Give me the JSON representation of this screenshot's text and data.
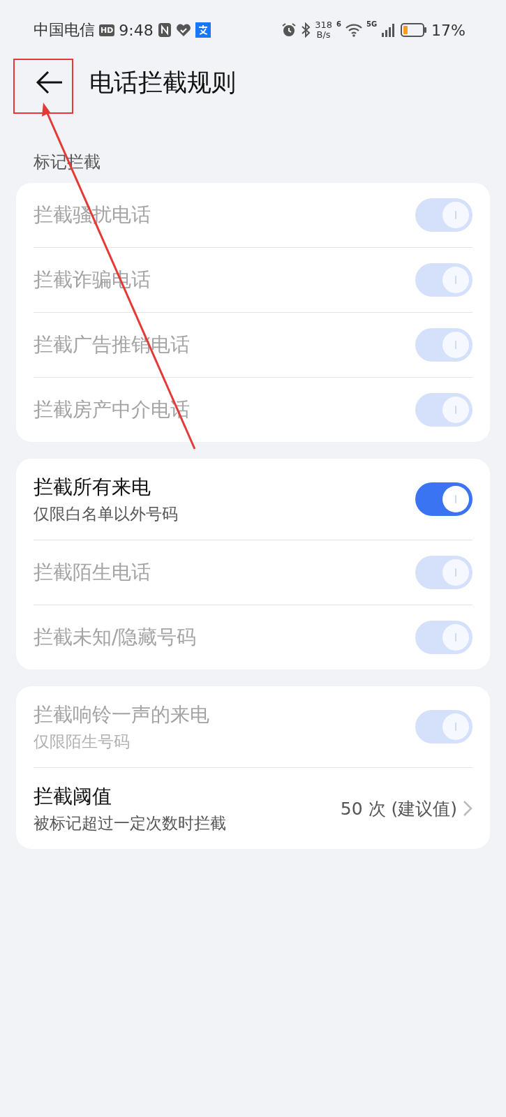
{
  "status_bar": {
    "carrier": "中国电信",
    "hd": "HD",
    "time": "9:48",
    "speed_value": "318",
    "speed_unit": "B/s",
    "wifi_label": "6",
    "network": "5G",
    "battery": "17%"
  },
  "header": {
    "title": "电话拦截规则"
  },
  "sections": [
    {
      "label": "标记拦截",
      "rows": [
        {
          "kind": "toggle",
          "title": "拦截骚扰电话",
          "on": true,
          "disabled": true
        },
        {
          "kind": "toggle",
          "title": "拦截诈骗电话",
          "on": true,
          "disabled": true
        },
        {
          "kind": "toggle",
          "title": "拦截广告推销电话",
          "on": true,
          "disabled": true
        },
        {
          "kind": "toggle",
          "title": "拦截房产中介电话",
          "on": true,
          "disabled": true
        }
      ]
    },
    {
      "rows": [
        {
          "kind": "toggle",
          "title": "拦截所有来电",
          "subtitle": "仅限白名单以外号码",
          "on": true,
          "disabled": false
        },
        {
          "kind": "toggle",
          "title": "拦截陌生电话",
          "on": true,
          "disabled": true
        },
        {
          "kind": "toggle",
          "title": "拦截未知/隐藏号码",
          "on": true,
          "disabled": true
        }
      ]
    },
    {
      "rows": [
        {
          "kind": "toggle",
          "title": "拦截响铃一声的来电",
          "subtitle": "仅限陌生号码",
          "on": true,
          "disabled": true
        },
        {
          "kind": "link",
          "title": "拦截阈值",
          "subtitle": "被标记超过一定次数时拦截",
          "value": "50 次 (建议值)"
        }
      ]
    }
  ],
  "annotation": {
    "box": true,
    "arrow": true
  }
}
